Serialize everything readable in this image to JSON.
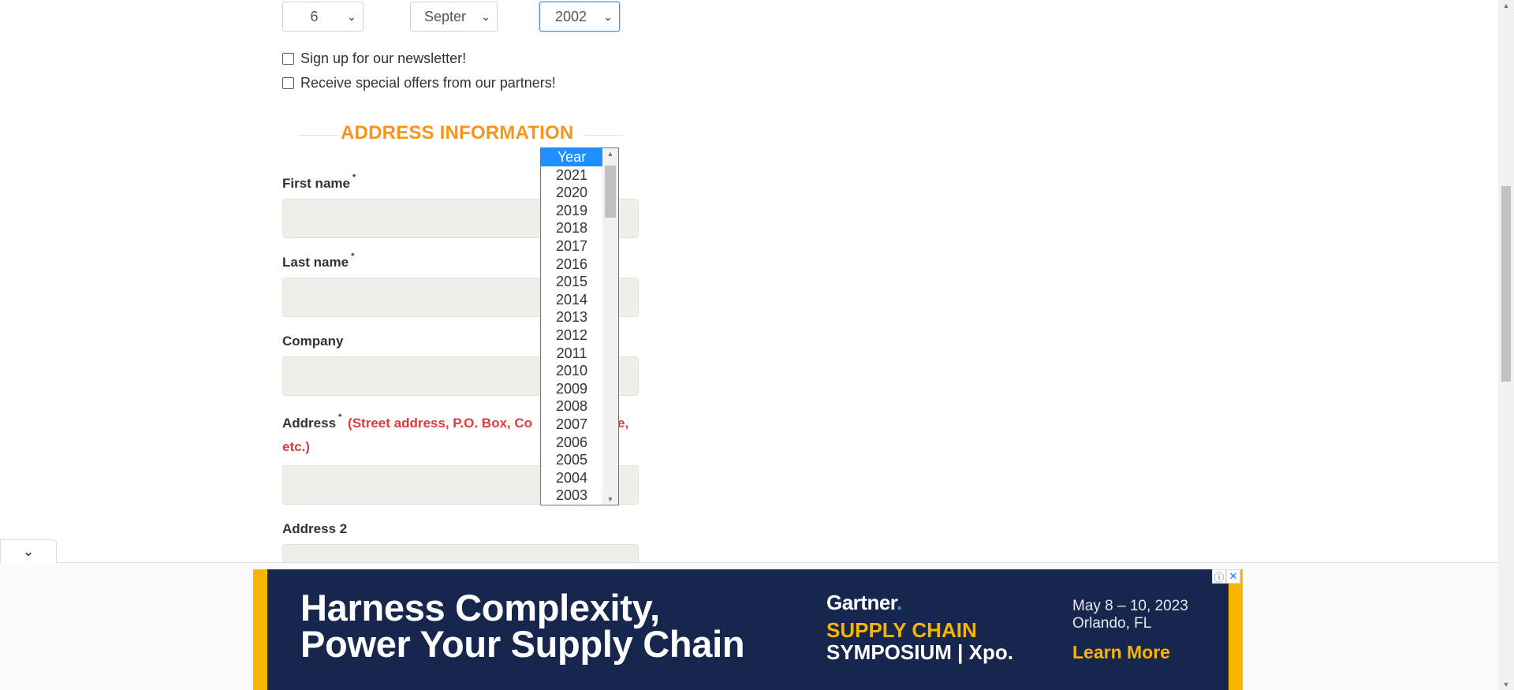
{
  "dob": {
    "day": "6",
    "month": "Septer",
    "year": "2002"
  },
  "checkboxes": {
    "newsletter": "Sign up for our newsletter!",
    "offers": "Receive special offers from our partners!"
  },
  "section_title": "ADDRESS INFORMATION",
  "fields": {
    "first_name": "First name",
    "last_name": "Last name",
    "company": "Company",
    "address": "Address",
    "address_hint": "(Street address, P.O. Box, Co",
    "address_hint_tail": "e,",
    "address_hint_line2": "etc.)",
    "address2": "Address 2",
    "required_mark": "*"
  },
  "year_dropdown": {
    "options": [
      "Year",
      "2021",
      "2020",
      "2019",
      "2018",
      "2017",
      "2016",
      "2015",
      "2014",
      "2013",
      "2012",
      "2011",
      "2010",
      "2009",
      "2008",
      "2007",
      "2006",
      "2005",
      "2004",
      "2003"
    ],
    "highlighted": "Year"
  },
  "ad": {
    "headline_line1": "Harness Complexity,",
    "headline_line2": "Power Your Supply Chain",
    "brand": "Gartner",
    "brand_dot": ".",
    "event_line1": "SUPPLY CHAIN",
    "event_line2": "SYMPOSIUM | Xpo.",
    "date_line1": "May 8 – 10, 2023",
    "date_line2": "Orlando, FL",
    "cta": "Learn More",
    "info_icon": "info-icon",
    "close_icon": "close-icon"
  },
  "colors": {
    "section_title": "#f7941d",
    "hint": "#e03a3a",
    "dropdown_highlight": "#1e90ff",
    "ad_bg": "#16264d",
    "ad_accent": "#f7b500"
  }
}
